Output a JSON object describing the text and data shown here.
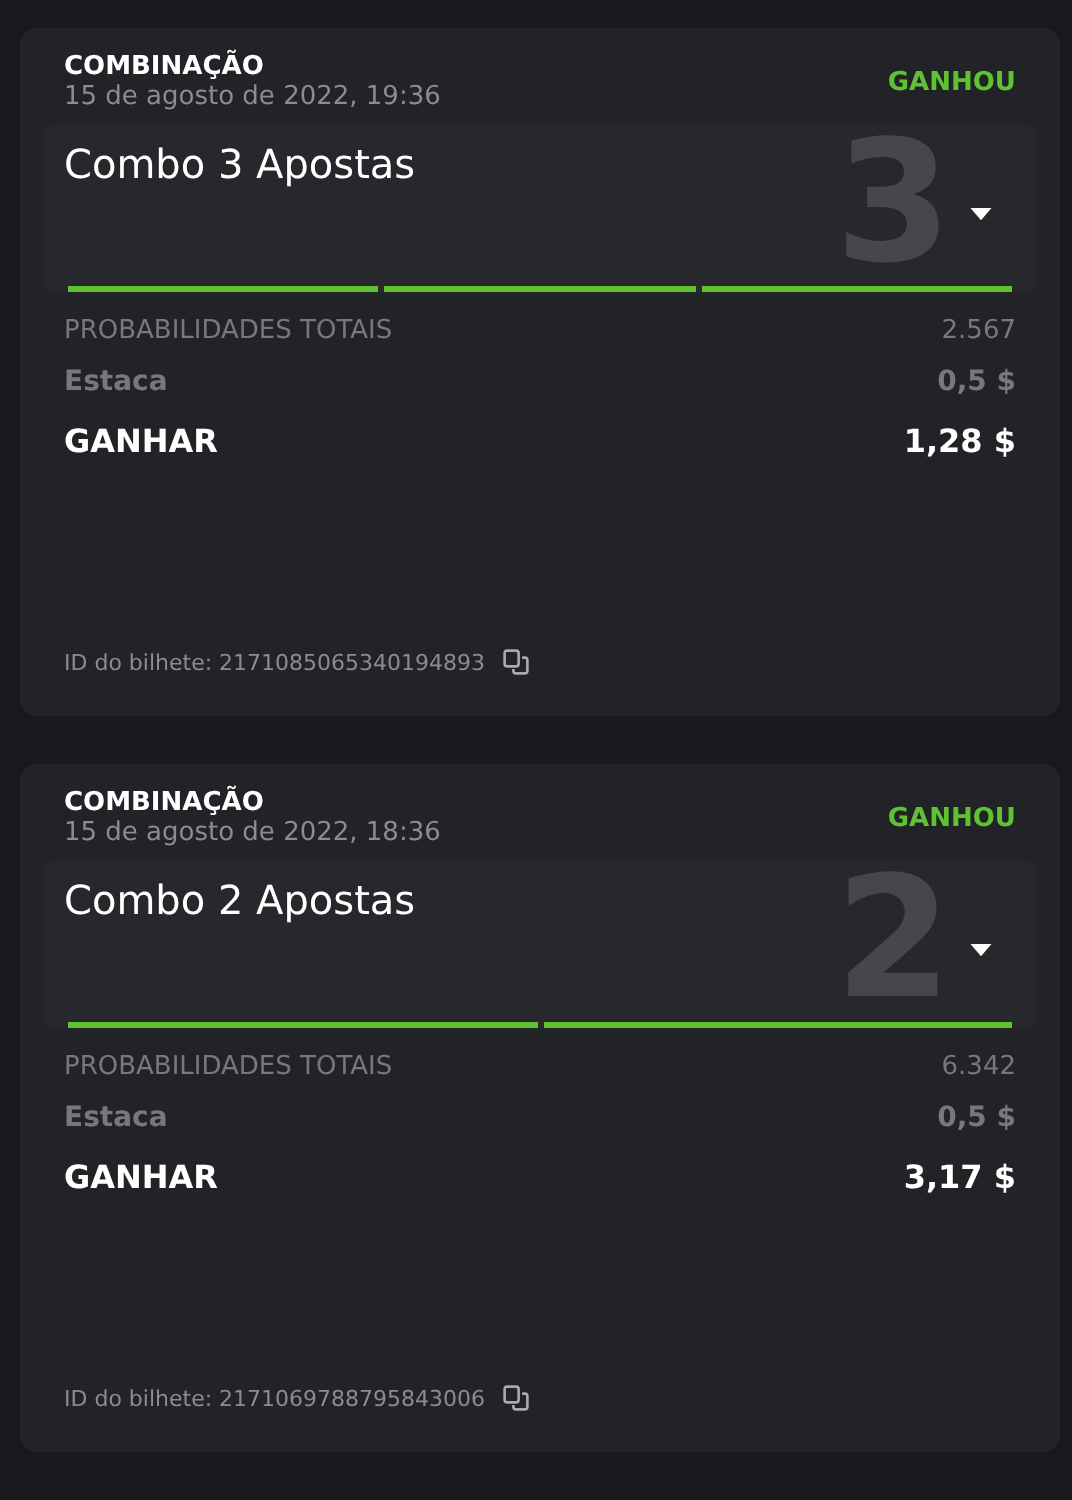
{
  "tickets": [
    {
      "type": "COMBINAÇÃO",
      "date": "15 de agosto de 2022, 19:36",
      "status": "GANHOU",
      "won": true,
      "combo_title": "Combo 3 Apostas",
      "combo_count": "3",
      "expanded": false,
      "legs": [
        {
          "won": true
        },
        {
          "won": true
        },
        {
          "won": true
        }
      ],
      "odds_label": "PROBABILIDADES TOTAIS",
      "odds": "2.567",
      "stake_label": "Estaca",
      "stake": "0,5 $",
      "win_label": "GANHAR",
      "win": "1,28 $",
      "ticket_id": "ID do bilhete: 2171085065340194893"
    },
    {
      "type": "COMBINAÇÃO",
      "date": "15 de agosto de 2022, 18:36",
      "status": "GANHOU",
      "won": true,
      "combo_title": "Combo 2 Apostas",
      "combo_count": "2",
      "expanded": false,
      "legs": [
        {
          "won": true
        },
        {
          "won": true
        }
      ],
      "odds_label": "PROBABILIDADES TOTAIS",
      "odds": "6.342",
      "stake_label": "Estaca",
      "stake": "0,5 $",
      "win_label": "GANHAR",
      "win": "3,17 $",
      "ticket_id": "ID do bilhete: 2171069788795843006"
    }
  ]
}
